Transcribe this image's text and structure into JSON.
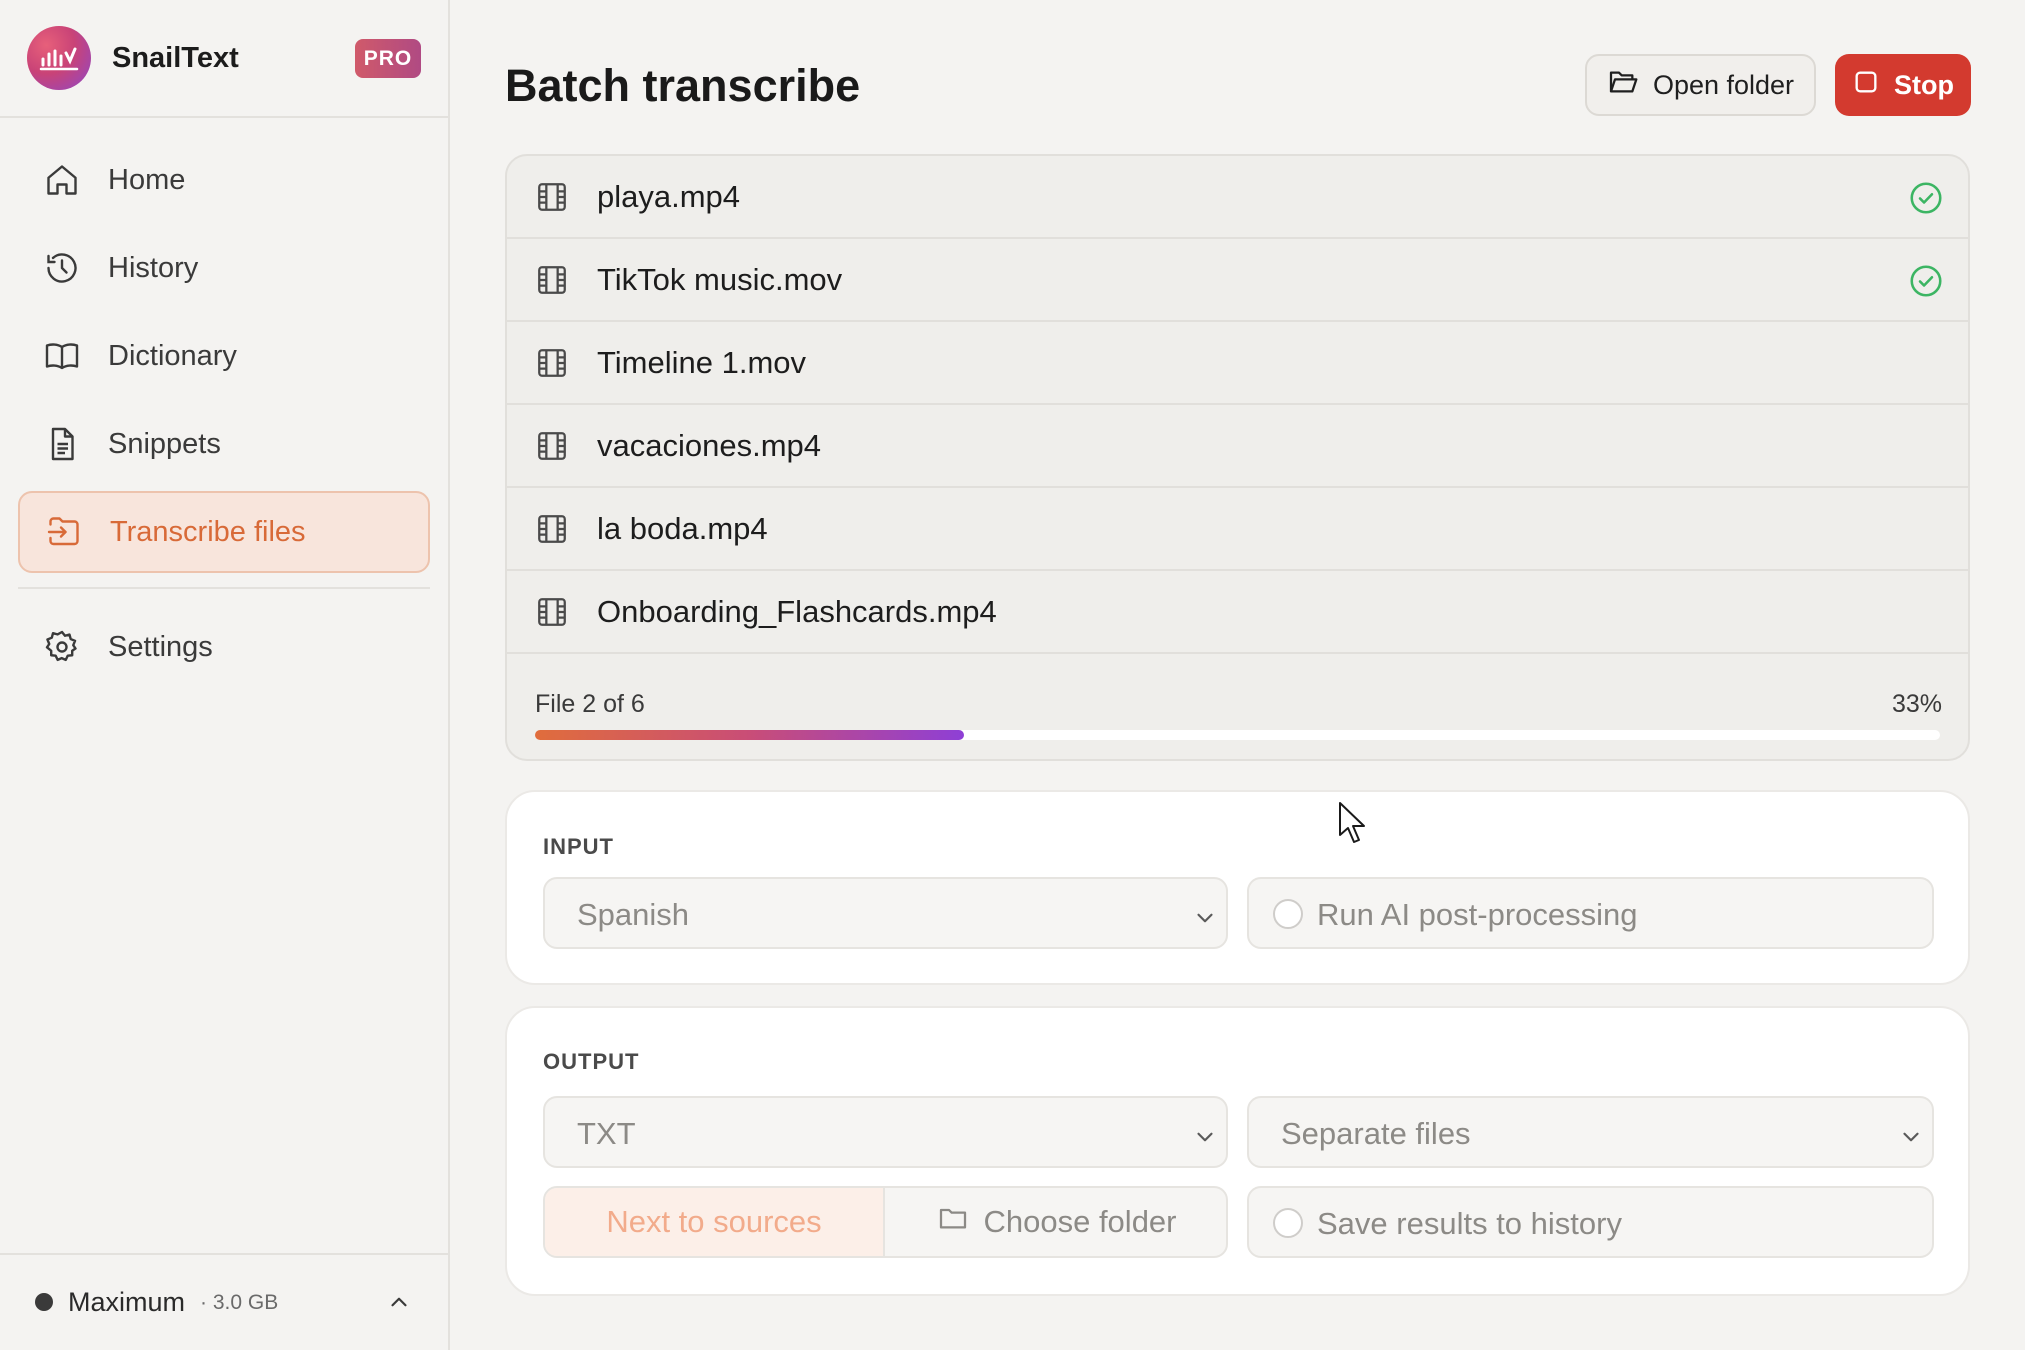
{
  "app": {
    "name": "SnailText",
    "badge": "PRO"
  },
  "sidebar": {
    "items": [
      {
        "label": "Home",
        "icon": "home-icon"
      },
      {
        "label": "History",
        "icon": "history-icon"
      },
      {
        "label": "Dictionary",
        "icon": "book-icon"
      },
      {
        "label": "Snippets",
        "icon": "document-icon"
      },
      {
        "label": "Transcribe files",
        "icon": "file-import-icon",
        "active": true
      },
      {
        "label": "Settings",
        "icon": "gear-icon"
      }
    ],
    "footer": {
      "model": "Maximum",
      "size": "· 3.0 GB"
    }
  },
  "main": {
    "title": "Batch transcribe",
    "open_folder_label": "Open folder",
    "stop_label": "Stop",
    "files": [
      {
        "name": "playa.mp4",
        "done": true
      },
      {
        "name": "TikTok music.mov",
        "done": true
      },
      {
        "name": "Timeline 1.mov",
        "done": false
      },
      {
        "name": "vacaciones.mp4",
        "done": false
      },
      {
        "name": "la boda.mp4",
        "done": false
      },
      {
        "name": "Onboarding_Flashcards.mp4",
        "done": false
      }
    ],
    "progress": {
      "label": "File 2 of 6",
      "percent_text": "33%",
      "value": 0.305
    }
  },
  "input": {
    "section_label": "INPUT",
    "language": "Spanish",
    "ai_postprocess_label": "Run AI post-processing"
  },
  "output": {
    "section_label": "OUTPUT",
    "format": "TXT",
    "mode": "Separate files",
    "location_next": "Next to sources",
    "location_choose": "Choose folder",
    "save_history_label": "Save results to history"
  },
  "colors": {
    "accent": "#d86a38",
    "stop": "#d33a2f",
    "success": "#3cb563"
  }
}
